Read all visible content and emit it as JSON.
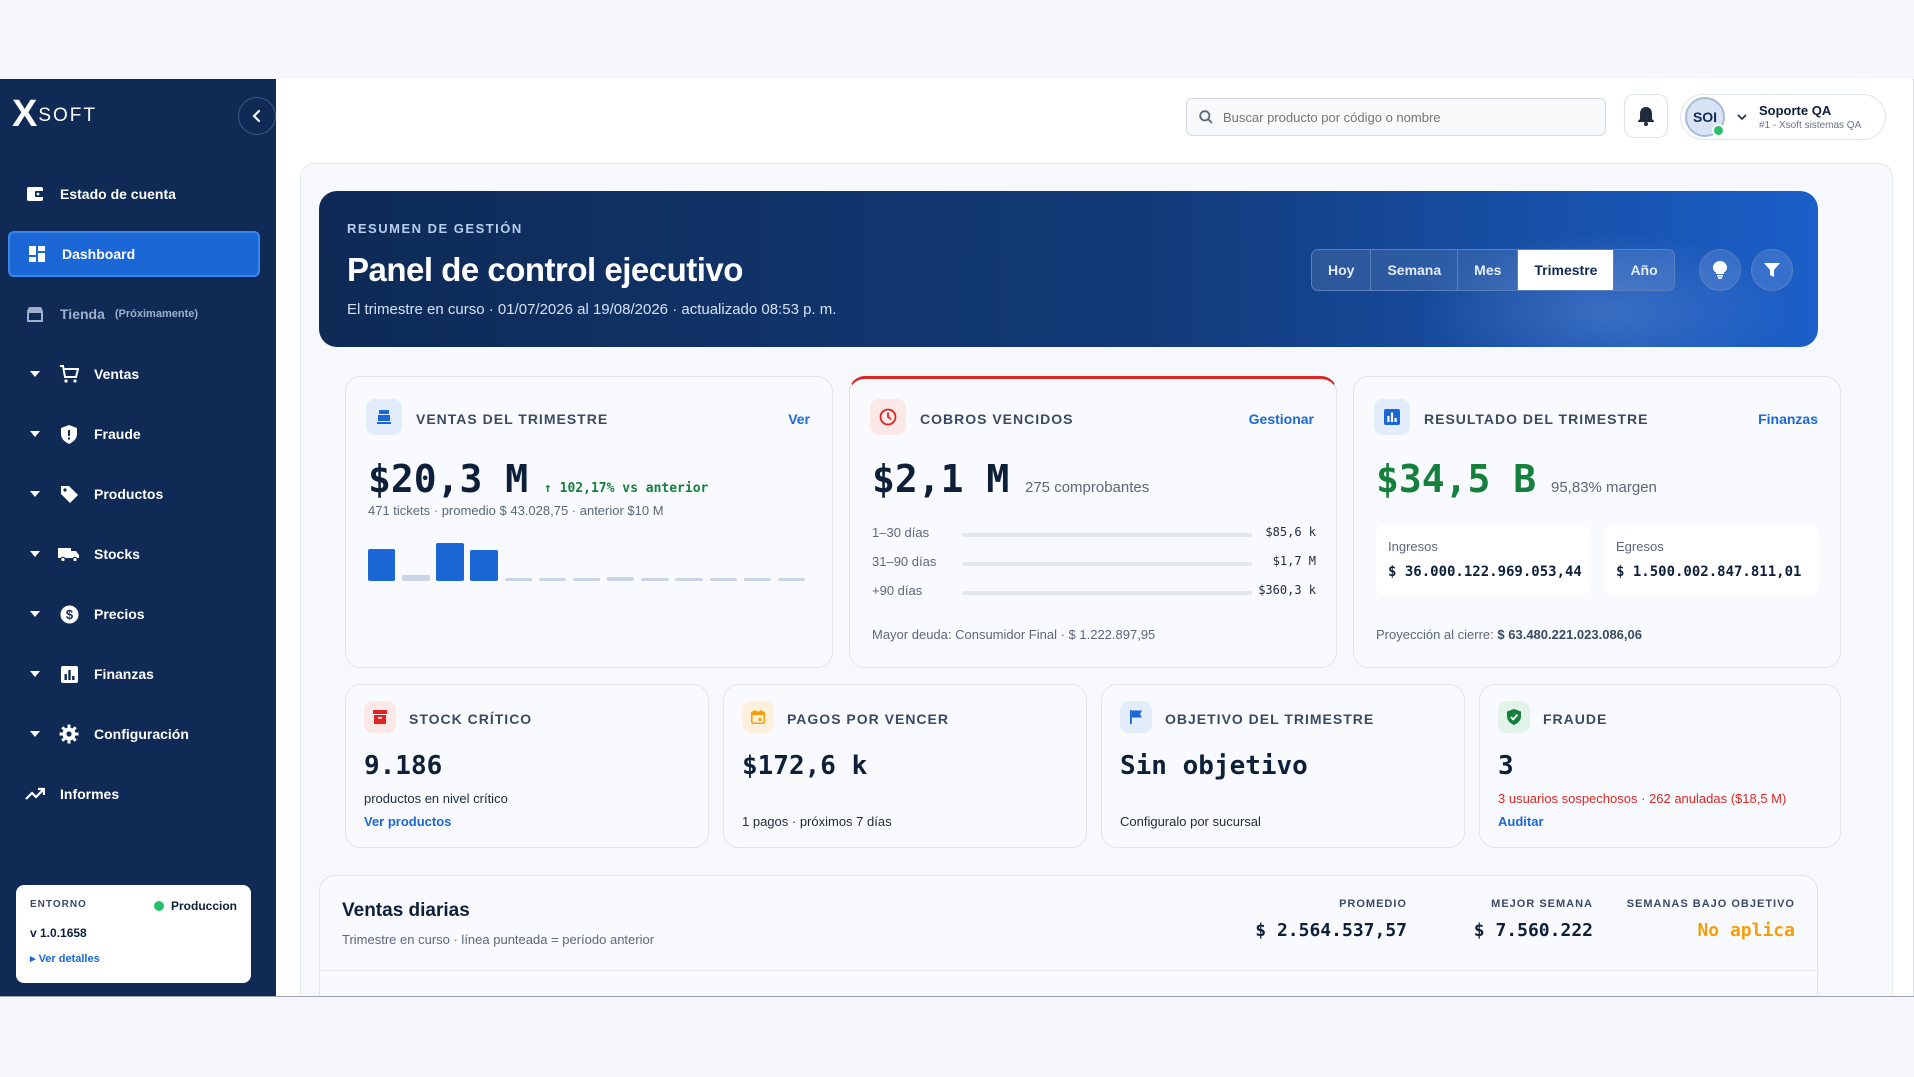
{
  "brand": {
    "logo_x": "X",
    "logo_soft": "SOFT"
  },
  "sidebar": {
    "items": [
      {
        "label": "Estado de cuenta"
      },
      {
        "label": "Dashboard"
      },
      {
        "label": "Tienda",
        "note": "(Próximamente)"
      },
      {
        "label": "Ventas"
      },
      {
        "label": "Fraude"
      },
      {
        "label": "Productos"
      },
      {
        "label": "Stocks"
      },
      {
        "label": "Precios"
      },
      {
        "label": "Finanzas"
      },
      {
        "label": "Configuración"
      },
      {
        "label": "Informes"
      }
    ],
    "env": {
      "label": "ENTORNO",
      "status": "Produccion",
      "version": "v 1.0.1658",
      "details": "▸ Ver detalles"
    }
  },
  "topbar": {
    "search_placeholder": "Buscar producto por código o nombre",
    "user": {
      "initials": "SOI",
      "name": "Soporte QA",
      "sub": "#1 - Xsoft sistemas QA"
    }
  },
  "hero": {
    "kicker": "RESUMEN DE GESTIÓN",
    "title": "Panel de control ejecutivo",
    "subtitle": "El trimestre en curso · 01/07/2026 al 19/08/2026 · actualizado 08:53 p. m.",
    "periods": [
      "Hoy",
      "Semana",
      "Mes",
      "Trimestre",
      "Año"
    ],
    "active_period": "Trimestre"
  },
  "cards": {
    "ventas": {
      "label": "VENTAS DEL TRIMESTRE",
      "link": "Ver",
      "value": "$20,3 M",
      "delta": "↑ 102,17% vs anterior",
      "detail": "471 tickets · promedio $ 43.028,75 · anterior $10 M",
      "bars": [
        0.72,
        0.14,
        0.86,
        0.7,
        0.06,
        0.06,
        0.06,
        0.08,
        0.06,
        0.06,
        0.06,
        0.06,
        0.06
      ]
    },
    "cobros": {
      "label": "COBROS VENCIDOS",
      "link": "Gestionar",
      "value": "$2,1 M",
      "count": "275 comprobantes",
      "rows": [
        {
          "label": "1–30 días",
          "value": "$85,6 k"
        },
        {
          "label": "31–90 días",
          "value": "$1,7 M"
        },
        {
          "label": "+90 días",
          "value": "$360,3 k"
        }
      ],
      "footer": "Mayor deuda: Consumidor Final · $ 1.222.897,95"
    },
    "resultado": {
      "label": "RESULTADO DEL TRIMESTRE",
      "link": "Finanzas",
      "value": "$34,5 B",
      "margin": "95,83% margen",
      "ingresos_label": "Ingresos",
      "ingresos_value": "$ 36.000.122.969.053,44",
      "egresos_label": "Egresos",
      "egresos_value": "$ 1.500.002.847.811,01",
      "footer_label": "Proyección al cierre:",
      "footer_value": "$ 63.480.221.023.086,06"
    },
    "stock": {
      "label": "STOCK CRÍTICO",
      "value": "9.186",
      "detail": "productos en nivel crítico",
      "link": "Ver productos"
    },
    "pagos": {
      "label": "PAGOS POR VENCER",
      "value": "$172,6 k",
      "detail": "1 pagos · próximos 7 días"
    },
    "objetivo": {
      "label": "OBJETIVO DEL TRIMESTRE",
      "value": "Sin objetivo",
      "detail": "Configuralo por sucursal"
    },
    "fraude": {
      "label": "FRAUDE",
      "value": "3",
      "detail": "3 usuarios sospechosos · 262 anuladas ($18,5 M)",
      "link": "Auditar"
    }
  },
  "ventas_diarias": {
    "title": "Ventas diarias",
    "subtitle": "Trimestre en curso · línea punteada = período anterior",
    "stats": [
      {
        "label": "PROMEDIO",
        "value": "$ 2.564.537,57"
      },
      {
        "label": "MEJOR SEMANA",
        "value": "$ 7.560.222"
      },
      {
        "label": "SEMANAS BAJO OBJETIVO",
        "value": "No aplica"
      }
    ]
  },
  "colors": {
    "sidebar": "#0e2a55",
    "accent": "#1b67d6",
    "success": "#15803d",
    "danger": "#dc2626",
    "warning": "#f59e0b"
  }
}
